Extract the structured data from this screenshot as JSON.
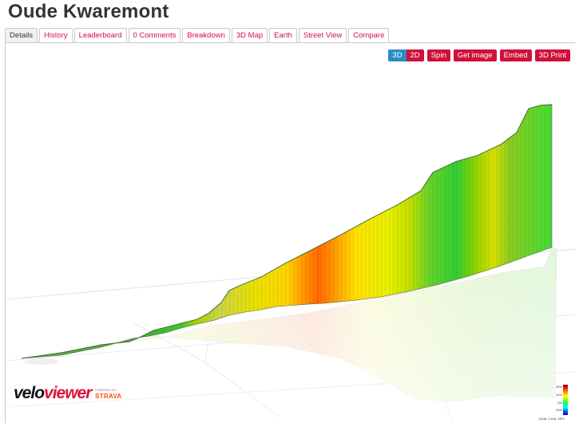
{
  "title": "Oude Kwaremont",
  "tabs": [
    {
      "label": "Details",
      "active": true
    },
    {
      "label": "History"
    },
    {
      "label": "Leaderboard"
    },
    {
      "label": "0 Comments"
    },
    {
      "label": "Breakdown"
    },
    {
      "label": "3D Map"
    },
    {
      "label": "Earth"
    },
    {
      "label": "Street View"
    },
    {
      "label": "Compare"
    }
  ],
  "toolbar": {
    "btn_3d": "3D",
    "btn_2d": "2D",
    "spin": "Spin",
    "get_image": "Get image",
    "embed": "Embed",
    "print3d": "3D Print"
  },
  "branding": {
    "velo": "velo",
    "viewer": "viewer",
    "powered_by": "POWERED BY",
    "strava": "STRAVA"
  },
  "legend": {
    "labels": [
      "20%",
      "10%",
      "0%",
      "-10%"
    ],
    "note": "(Grid: 1 km) -25%"
  },
  "colors": {
    "accent_red": "#d0103a",
    "accent_blue": "#2a8cc4",
    "strava_orange": "#fc4c02"
  }
}
